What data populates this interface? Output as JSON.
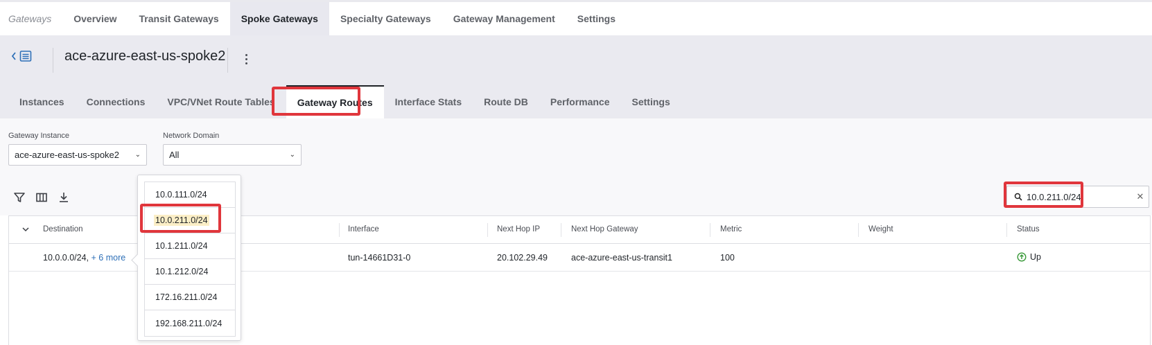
{
  "topnav": {
    "crumb": "Gateways",
    "tabs": [
      {
        "label": "Overview"
      },
      {
        "label": "Transit Gateways"
      },
      {
        "label": "Spoke Gateways"
      },
      {
        "label": "Specialty Gateways"
      },
      {
        "label": "Gateway Management"
      },
      {
        "label": "Settings"
      }
    ],
    "active_tab": "Spoke Gateways"
  },
  "header": {
    "gateway_name": "ace-azure-east-us-spoke2"
  },
  "subtabs": {
    "tabs": [
      {
        "label": "Instances"
      },
      {
        "label": "Connections"
      },
      {
        "label": "VPC/VNet Route Tables"
      },
      {
        "label": "Gateway Routes"
      },
      {
        "label": "Interface Stats"
      },
      {
        "label": "Route DB"
      },
      {
        "label": "Performance"
      },
      {
        "label": "Settings"
      }
    ],
    "active_tab": "Gateway Routes"
  },
  "filters": {
    "gateway_instance": {
      "label": "Gateway Instance",
      "value": "ace-azure-east-us-spoke2"
    },
    "network_domain": {
      "label": "Network Domain",
      "value": "All"
    }
  },
  "search": {
    "value": "10.0.211.0/24"
  },
  "table": {
    "columns": [
      "Destination",
      "Interface",
      "Next Hop IP",
      "Next Hop Gateway",
      "Metric",
      "Weight",
      "Status"
    ],
    "rows": [
      {
        "destination": "10.0.0.0/24,",
        "more": "+ 6 more",
        "interface": "tun-14661D31-0",
        "next_hop_ip": "20.102.29.49",
        "next_hop_gateway": "ace-azure-east-us-transit1",
        "metric": "100",
        "weight": "",
        "status": "Up"
      }
    ]
  },
  "popover": {
    "items": [
      "10.0.111.0/24",
      "10.0.211.0/24",
      "10.1.211.0/24",
      "10.1.212.0/24",
      "172.16.211.0/24",
      "192.168.211.0/24"
    ],
    "highlighted": "10.0.211.0/24"
  },
  "colors": {
    "highlight_box": "#e0363c",
    "status_up": "#3a9a3a",
    "link": "#2d6fb7"
  }
}
